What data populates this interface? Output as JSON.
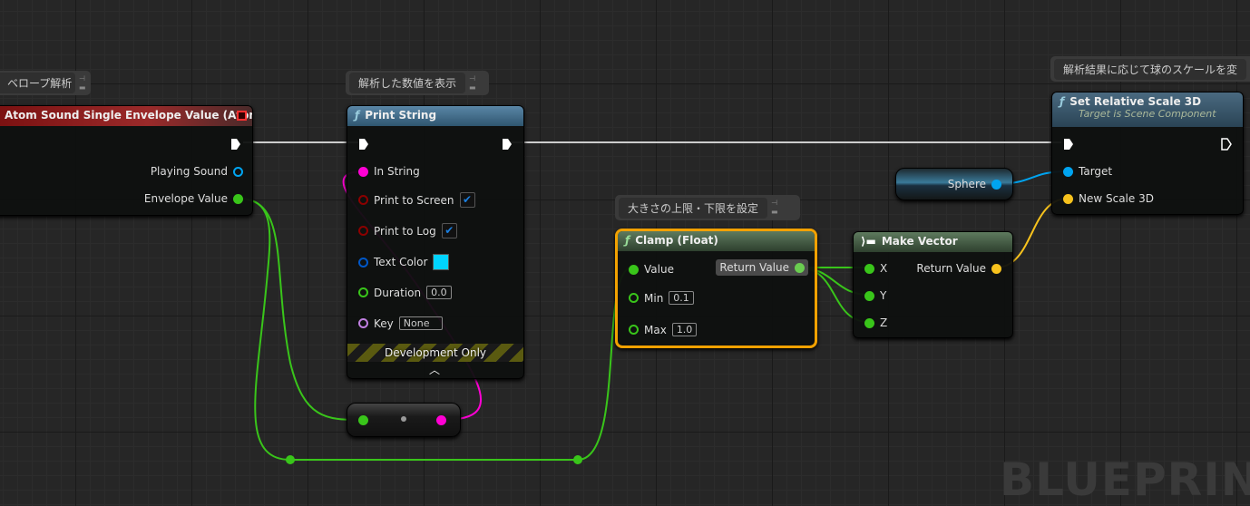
{
  "comments": {
    "envelope": "ベロープ解析",
    "print": "解析した数値を表示",
    "clamp": "大きさの上限・下限を設定",
    "scale": "解析結果に応じて球のスケールを変"
  },
  "atom_node": {
    "title": "Atom Sound Single Envelope Value (Atom)",
    "pins": {
      "playing": "Playing Sound",
      "envelope": "Envelope Value"
    },
    "color": "#8a1c1c"
  },
  "print_node": {
    "title": "Print String",
    "pins": {
      "in_string": "In String",
      "to_screen": "Print to Screen",
      "to_log": "Print to Log",
      "text_color": "Text Color",
      "duration": "Duration",
      "key": "Key"
    },
    "to_screen_checked": true,
    "to_log_checked": true,
    "text_color_value": "#00d4ff",
    "duration_value": "0.0",
    "key_value": "None",
    "footer": "Development Only"
  },
  "clamp_node": {
    "title": "Clamp (Float)",
    "pins": {
      "value": "Value",
      "min": "Min",
      "max": "Max",
      "ret": "Return Value"
    },
    "min_value": "0.1",
    "max_value": "1.0"
  },
  "vector_node": {
    "title": "Make Vector",
    "pins": {
      "x": "X",
      "y": "Y",
      "z": "Z",
      "ret": "Return Value"
    }
  },
  "sphere_node": {
    "label": "Sphere"
  },
  "scale_node": {
    "title": "Set Relative Scale 3D",
    "subtitle": "Target is Scene Component",
    "pins": {
      "target": "Target",
      "new_scale": "New Scale 3D"
    }
  },
  "watermark": "BLUEPRINT",
  "colors": {
    "exec": "#ffffff",
    "float": "#39c51a",
    "string": "#ff00d4",
    "bool": "#8c0000",
    "object": "#00a4f0",
    "vector": "#f7c21d",
    "name": "#c07fe0",
    "linear_color": "#0057c8",
    "selection": "#f2a100"
  }
}
